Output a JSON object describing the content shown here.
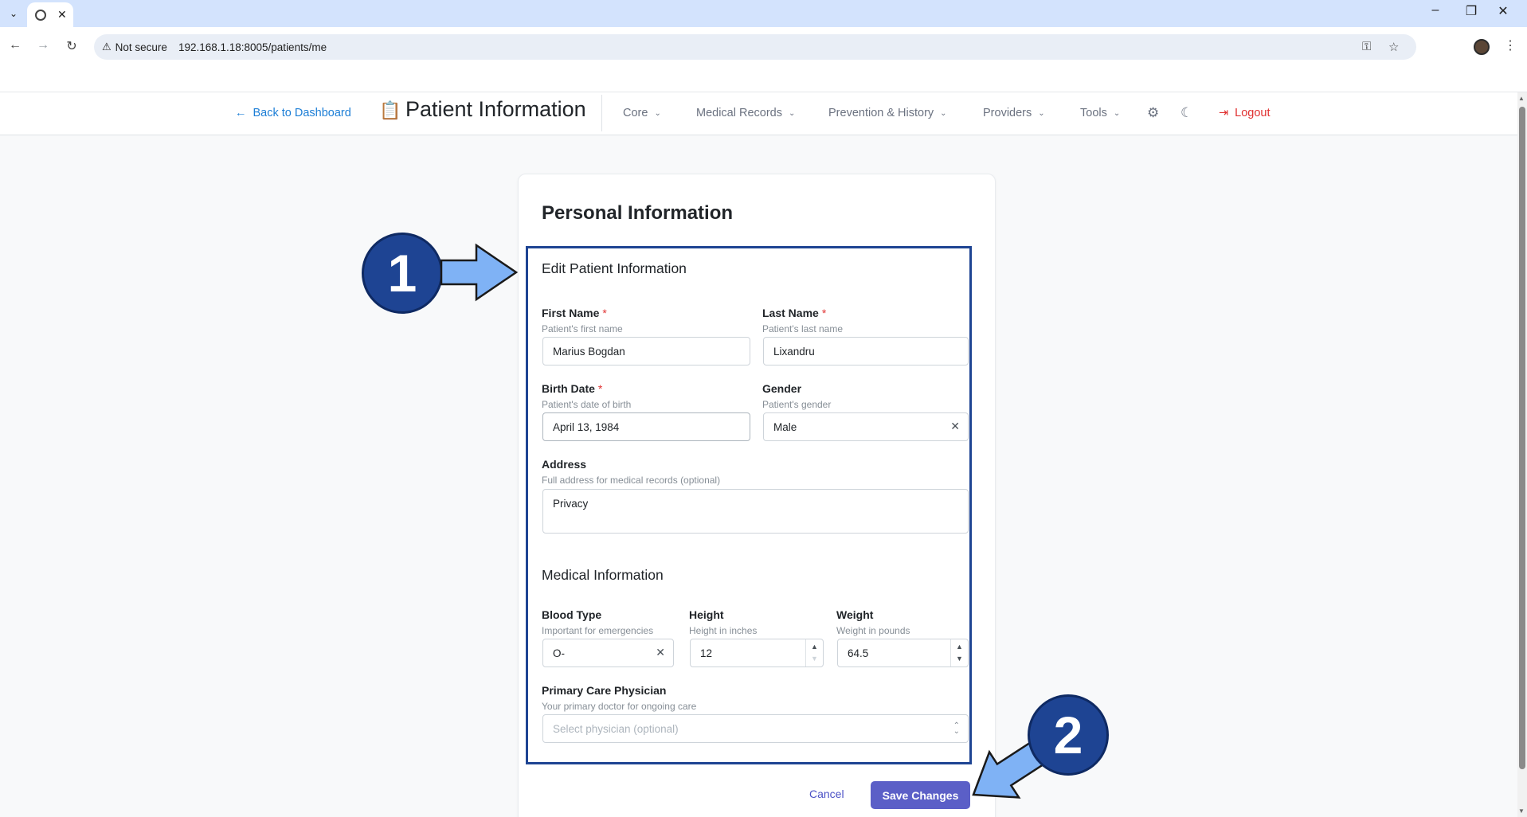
{
  "browser": {
    "tab_close": "✕",
    "security_label": "Not secure",
    "url": "192.168.1.18:8005/patients/me"
  },
  "header": {
    "back_label": "Back to Dashboard",
    "title": "Patient Information",
    "menus": [
      {
        "label": "Core"
      },
      {
        "label": "Medical Records"
      },
      {
        "label": "Prevention & History"
      },
      {
        "label": "Providers"
      },
      {
        "label": "Tools"
      }
    ],
    "logout_label": "Logout"
  },
  "card": {
    "title": "Personal Information",
    "form_title": "Edit Patient Information",
    "first_name": {
      "label": "First Name",
      "desc": "Patient's first name",
      "value": "Marius Bogdan"
    },
    "last_name": {
      "label": "Last Name",
      "desc": "Patient's last name",
      "value": "Lixandru"
    },
    "birth_date": {
      "label": "Birth Date",
      "desc": "Patient's date of birth",
      "value": "April 13, 1984"
    },
    "gender": {
      "label": "Gender",
      "desc": "Patient's gender",
      "value": "Male"
    },
    "address": {
      "label": "Address",
      "desc": "Full address for medical records (optional)",
      "value": "Privacy"
    },
    "medical_title": "Medical Information",
    "blood_type": {
      "label": "Blood Type",
      "desc": "Important for emergencies",
      "value": "O-"
    },
    "height": {
      "label": "Height",
      "desc": "Height in inches",
      "value": "12"
    },
    "weight": {
      "label": "Weight",
      "desc": "Weight in pounds",
      "value": "64.5"
    },
    "physician": {
      "label": "Primary Care Physician",
      "desc": "Your primary doctor for ongoing care",
      "placeholder": "Select physician (optional)"
    },
    "required_mark": "*",
    "cancel_label": "Cancel",
    "save_label": "Save Changes"
  },
  "annotations": {
    "step1": "1",
    "step2": "2",
    "color": "#1e4493",
    "arrow_color": "#7fb2f5"
  }
}
